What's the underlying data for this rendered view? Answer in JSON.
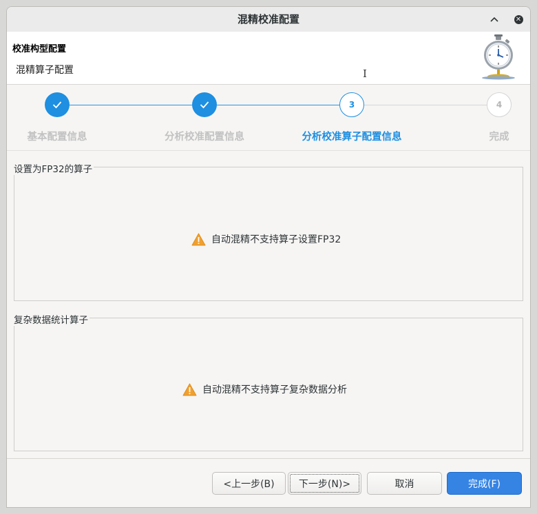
{
  "window": {
    "title": "混精校准配置"
  },
  "header": {
    "title": "校准构型配置",
    "subtitle": "混精算子配置"
  },
  "steps": [
    {
      "label": "基本配置信息",
      "number": "1",
      "state": "done"
    },
    {
      "label": "分析校准配置信息",
      "number": "2",
      "state": "done"
    },
    {
      "label": "分析校准算子配置信息",
      "number": "3",
      "state": "current"
    },
    {
      "label": "完成",
      "number": "4",
      "state": "todo"
    }
  ],
  "groups": [
    {
      "label": "设置为FP32的算子",
      "message": "自动混精不支持算子设置FP32",
      "icon": "warning-icon"
    },
    {
      "label": "复杂数据统计算子",
      "message": "自动混精不支持算子复杂数据分析",
      "icon": "warning-icon"
    }
  ],
  "buttons": {
    "prev": "<上一步(B)",
    "next": "下一步(N)>",
    "cancel": "取消",
    "finish": "完成(F)"
  },
  "colors": {
    "accent": "#1e8fe1",
    "warning": "#f0a030",
    "primary_button": "#3584e4"
  }
}
